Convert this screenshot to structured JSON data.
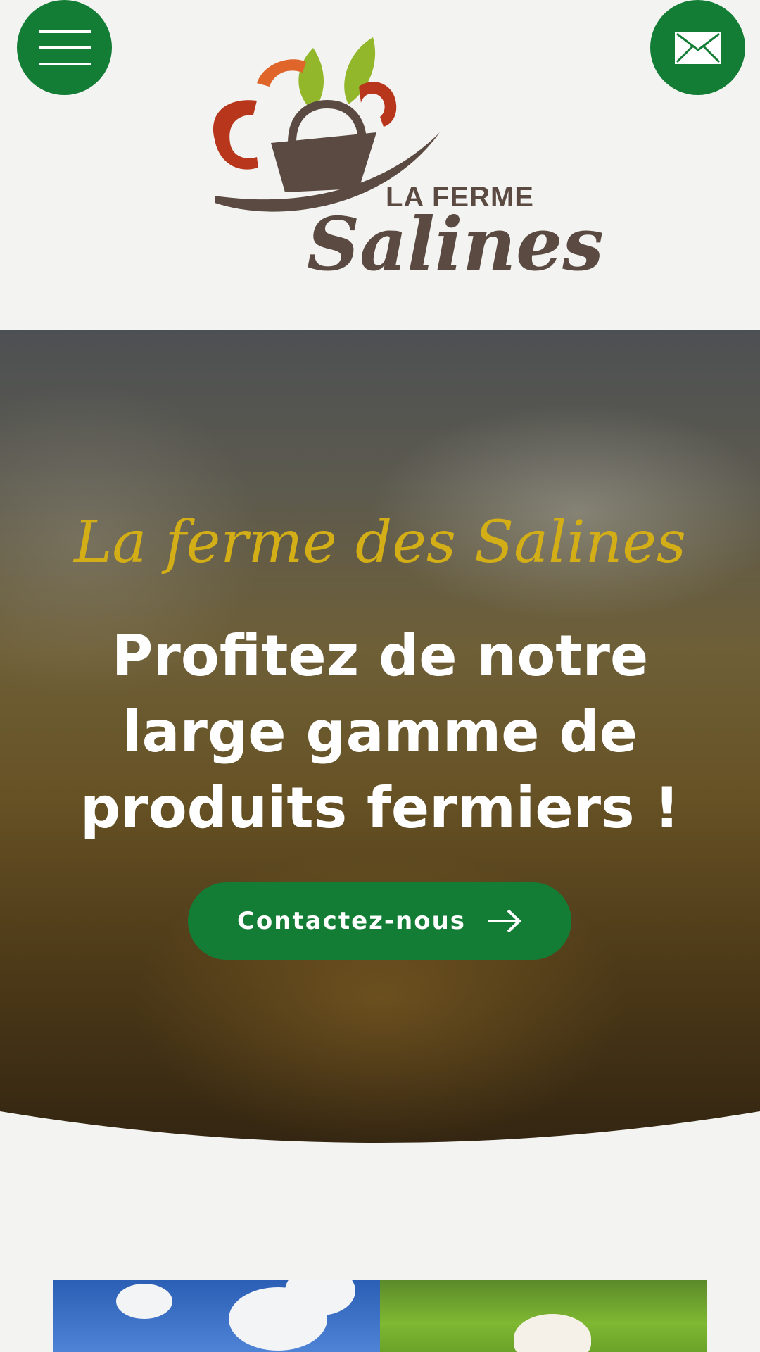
{
  "header": {
    "menu_icon": "hamburger-icon",
    "mail_icon": "envelope-icon",
    "logo": {
      "line1": "LA FERME",
      "line2": "Salines",
      "colors": {
        "brown": "#5b4a41",
        "red": "#b8361b",
        "orange": "#e0652a",
        "green": "#93b72a"
      }
    }
  },
  "hero": {
    "tagline": "La ferme des Salines",
    "title": "Profitez de notre large gamme de produits fermiers !",
    "cta_label": "Contactez-nous",
    "cta_icon": "arrow-right-icon"
  },
  "colors": {
    "accent_green": "#137d36",
    "tagline_gold": "#d3ae16",
    "page_bg": "#f3f3f1"
  }
}
